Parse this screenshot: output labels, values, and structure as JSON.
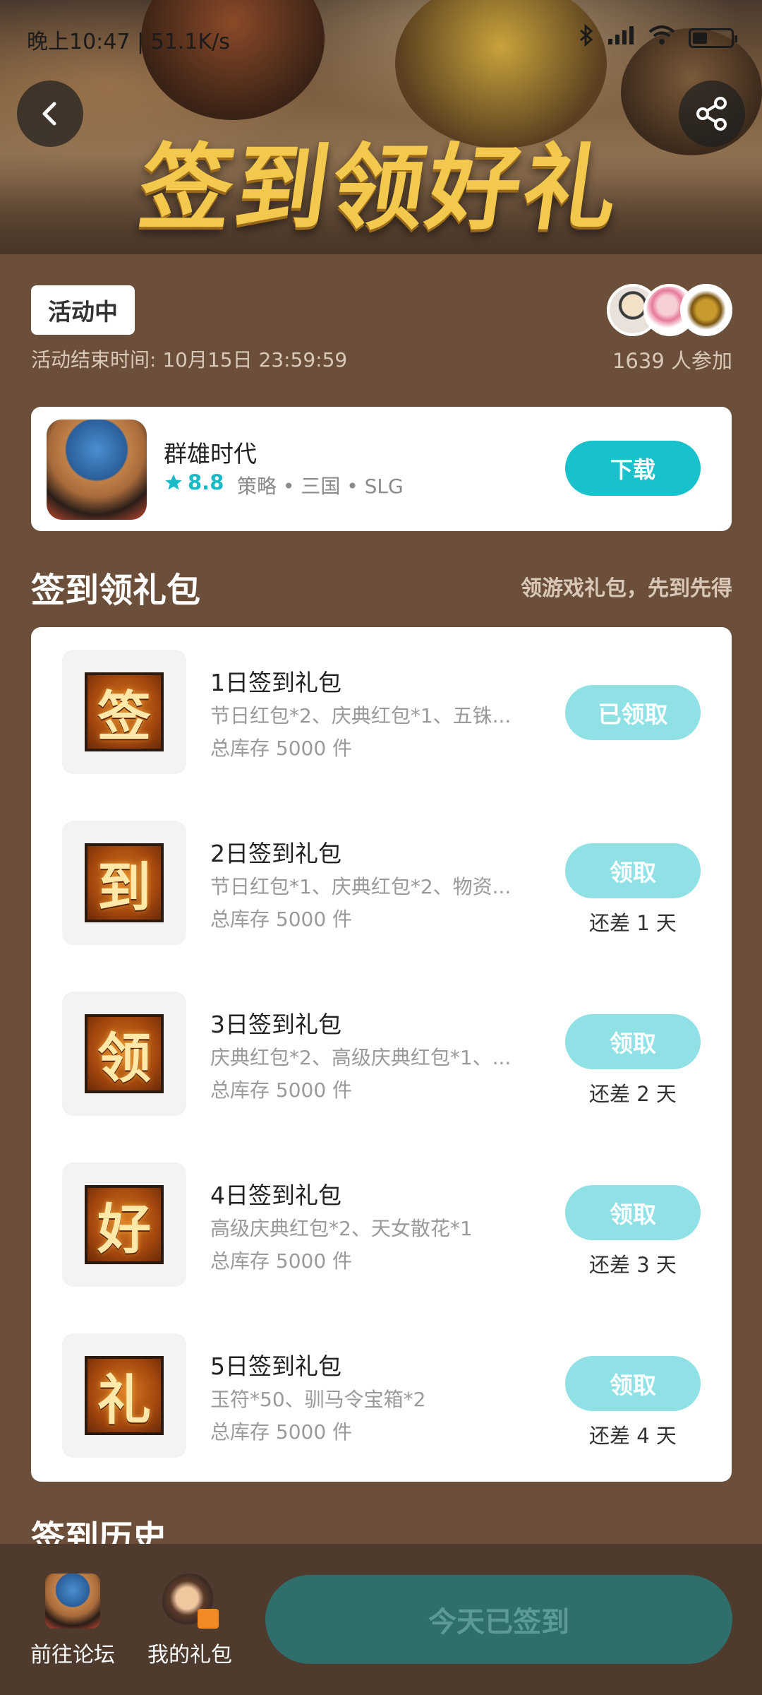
{
  "status_bar": {
    "time": "晚上10:47",
    "speed": "51.1K/s"
  },
  "banner": {
    "title": "签到领好礼"
  },
  "activity": {
    "status": "活动中",
    "end_time": "活动结束时间: 10月15日 23:59:59",
    "participants": "1639 人参加"
  },
  "game": {
    "name": "群雄时代",
    "rating": "8.8",
    "tags": "策略 • 三国 • SLG",
    "download_label": "下载"
  },
  "section": {
    "title": "签到领礼包",
    "subtitle": "领游戏礼包，先到先得"
  },
  "gifts": [
    {
      "icon_char": "签",
      "name": "1日签到礼包",
      "desc": "节日红包*2、庆典红包*1、五铢...",
      "stock": "总库存 5000 件",
      "button": "已领取",
      "remain": ""
    },
    {
      "icon_char": "到",
      "name": "2日签到礼包",
      "desc": "节日红包*1、庆典红包*2、物资...",
      "stock": "总库存 5000 件",
      "button": "领取",
      "remain": "还差 1 天"
    },
    {
      "icon_char": "领",
      "name": "3日签到礼包",
      "desc": "庆典红包*2、高级庆典红包*1、...",
      "stock": "总库存 5000 件",
      "button": "领取",
      "remain": "还差 2 天"
    },
    {
      "icon_char": "好",
      "name": "4日签到礼包",
      "desc": "高级庆典红包*2、天女散花*1",
      "stock": "总库存 5000 件",
      "button": "领取",
      "remain": "还差 3 天"
    },
    {
      "icon_char": "礼",
      "name": "5日签到礼包",
      "desc": "玉符*50、驯马令宝箱*2",
      "stock": "总库存 5000 件",
      "button": "领取",
      "remain": "还差 4 天"
    }
  ],
  "history": {
    "title": "签到历史"
  },
  "bottom": {
    "forum_label": "前往论坛",
    "my_gifts_label": "我的礼包",
    "checkin_label": "今天已签到"
  }
}
